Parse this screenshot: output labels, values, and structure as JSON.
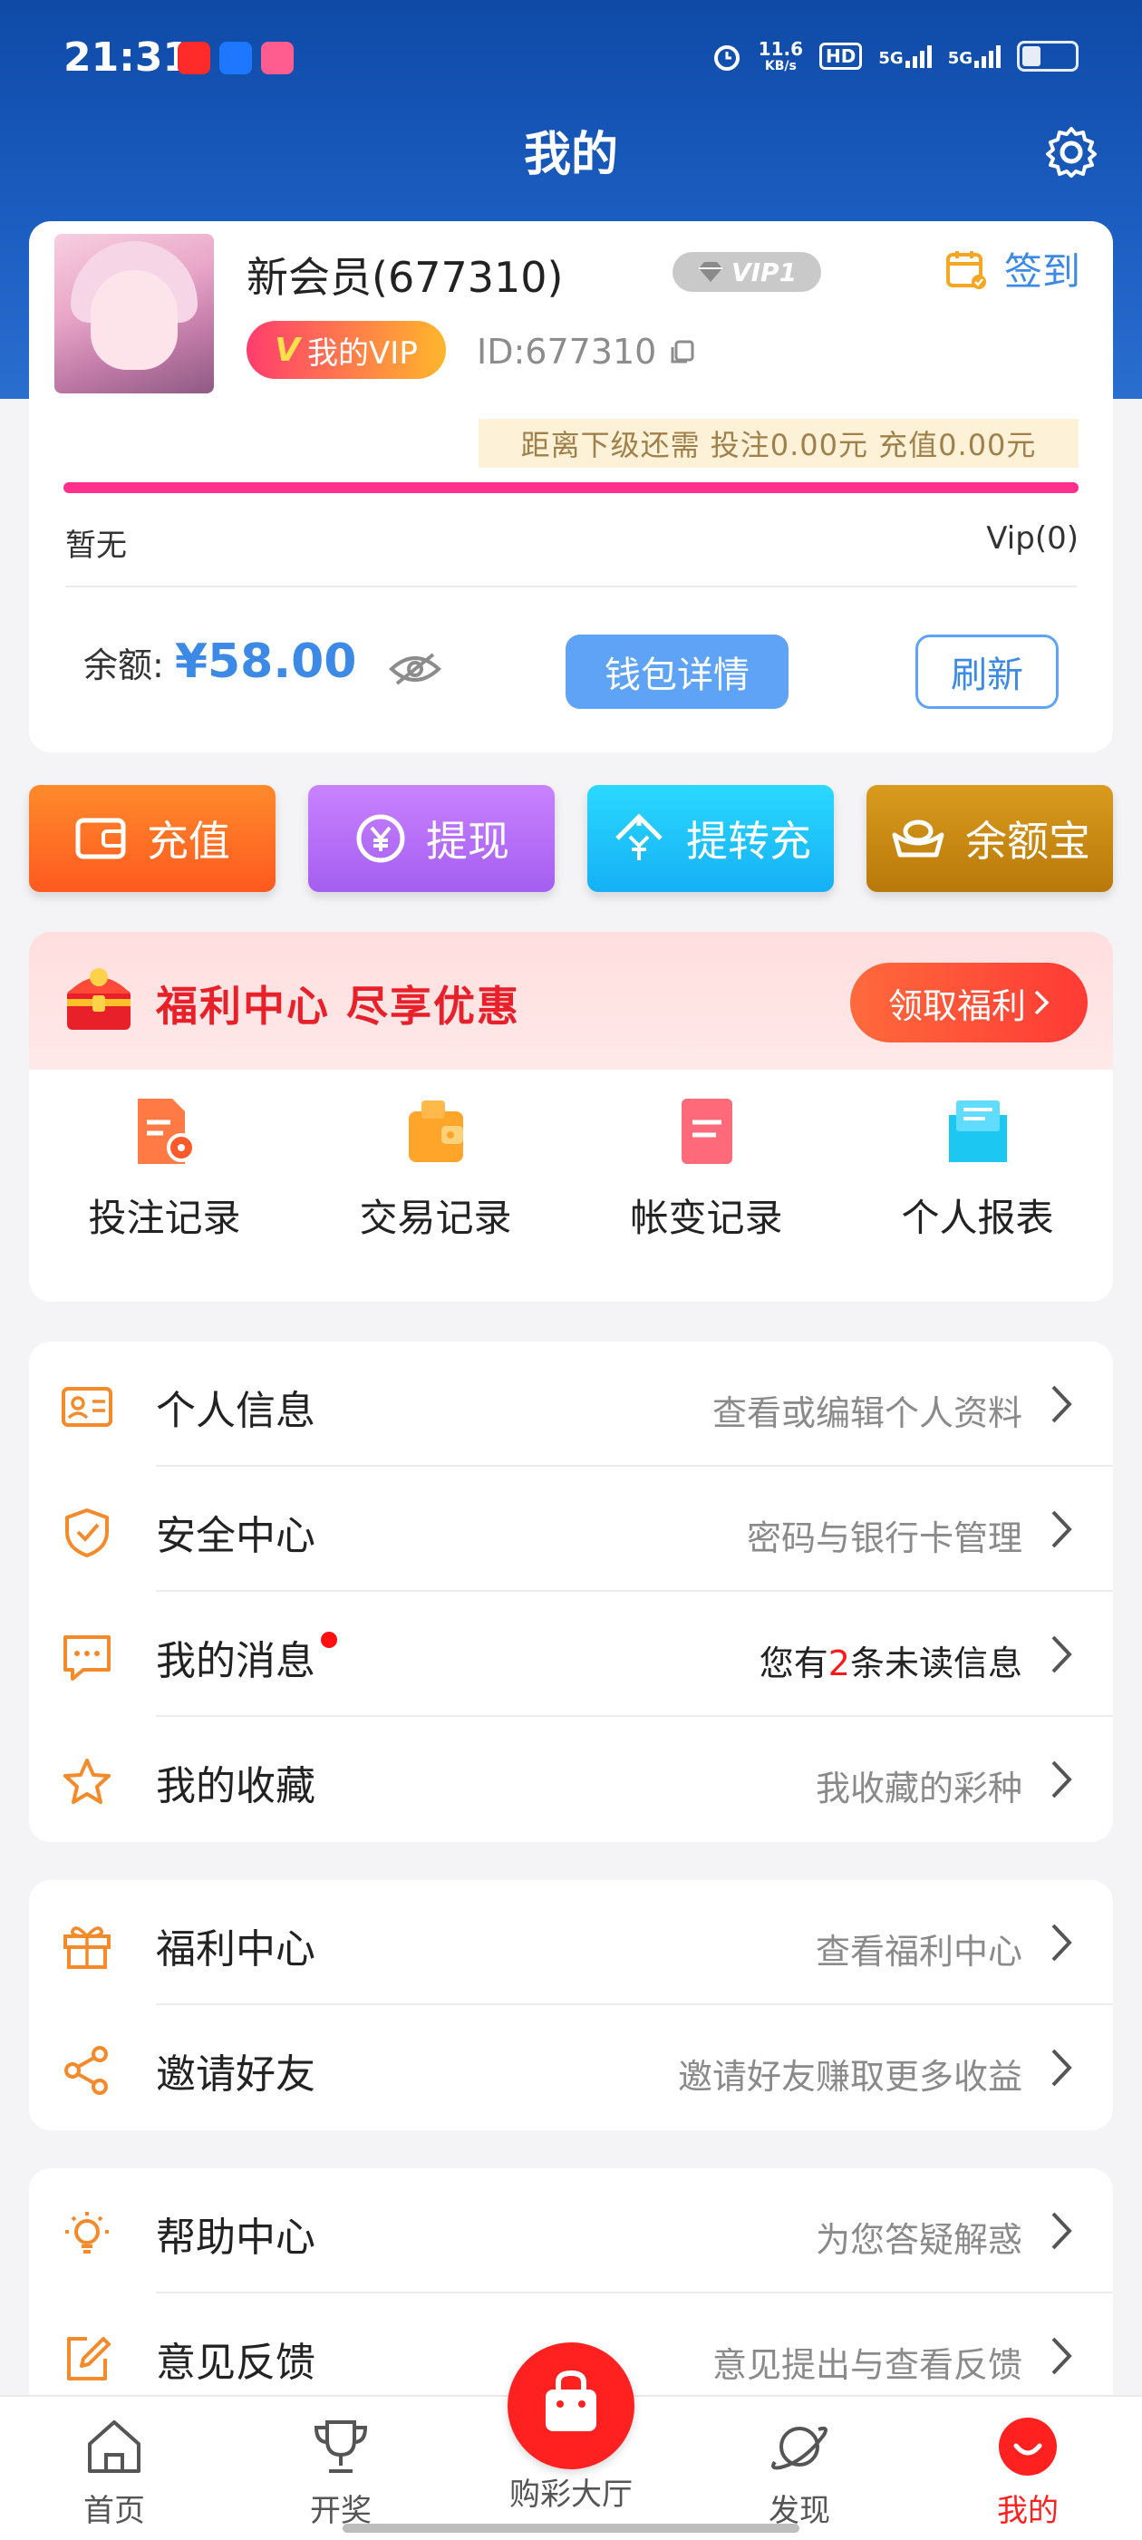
{
  "status_bar": {
    "time": "21:31",
    "net_speed_value": "11.6",
    "net_speed_unit": "KB/s",
    "hd_label": "HD",
    "sim1": "5G",
    "sim2": "5G"
  },
  "header": {
    "title": "我的"
  },
  "profile": {
    "username": "新会员(677310)",
    "vip_badge": "VIP1",
    "signin_label": "签到",
    "my_vip_label": "我的VIP",
    "my_vip_mark": "V",
    "user_id": "ID:677310",
    "next_level": "距离下级还需  投注0.00元  充值0.00元",
    "progress_left": "暂无",
    "progress_right": "Vip(0)",
    "balance_label": "余额:",
    "balance_amount": "¥58.00",
    "wallet_button": "钱包详情",
    "refresh_button": "刷新"
  },
  "actions": [
    {
      "label": "充值",
      "icon": "wallet-icon"
    },
    {
      "label": "提现",
      "icon": "yen-withdraw-icon"
    },
    {
      "label": "提转充",
      "icon": "transfer-icon"
    },
    {
      "label": "余额宝",
      "icon": "gold-ingot-icon"
    }
  ],
  "welfare": {
    "title": "福利中心 尽享优惠",
    "button": "领取福利",
    "records": [
      {
        "label": "投注记录",
        "icon": "bet-record-icon"
      },
      {
        "label": "交易记录",
        "icon": "transaction-record-icon"
      },
      {
        "label": "帐变记录",
        "icon": "account-change-icon"
      },
      {
        "label": "个人报表",
        "icon": "report-icon"
      }
    ]
  },
  "menu_group_1": [
    {
      "label": "个人信息",
      "sub": "查看或编辑个人资料",
      "icon": "id-card-icon"
    },
    {
      "label": "安全中心",
      "sub": "密码与银行卡管理",
      "icon": "shield-check-icon"
    },
    {
      "label": "我的消息",
      "sub_prefix": "您有",
      "sub_count": "2",
      "sub_suffix": "条未读信息",
      "icon": "message-icon"
    },
    {
      "label": "我的收藏",
      "sub": "我收藏的彩种",
      "icon": "star-icon"
    }
  ],
  "menu_group_2": [
    {
      "label": "福利中心",
      "sub": "查看福利中心",
      "icon": "gift-icon"
    },
    {
      "label": "邀请好友",
      "sub": "邀请好友赚取更多收益",
      "icon": "share-icon"
    }
  ],
  "menu_group_3": [
    {
      "label": "帮助中心",
      "sub": "为您答疑解惑",
      "icon": "lightbulb-icon"
    },
    {
      "label": "意见反馈",
      "sub": "意见提出与查看反馈",
      "icon": "feedback-edit-icon"
    }
  ],
  "tabbar": [
    {
      "label": "首页",
      "icon": "home-icon"
    },
    {
      "label": "开奖",
      "icon": "trophy-icon"
    },
    {
      "label": "购彩大厅",
      "icon": "shopping-bag-icon"
    },
    {
      "label": "发现",
      "icon": "planet-icon"
    },
    {
      "label": "我的",
      "icon": "profile-smile-icon"
    }
  ],
  "colors": {
    "header_blue": "#1b5dc0",
    "accent_blue": "#3d8ae6",
    "accent_red": "#ff2020",
    "progress_pink": "#ff2f8c"
  }
}
